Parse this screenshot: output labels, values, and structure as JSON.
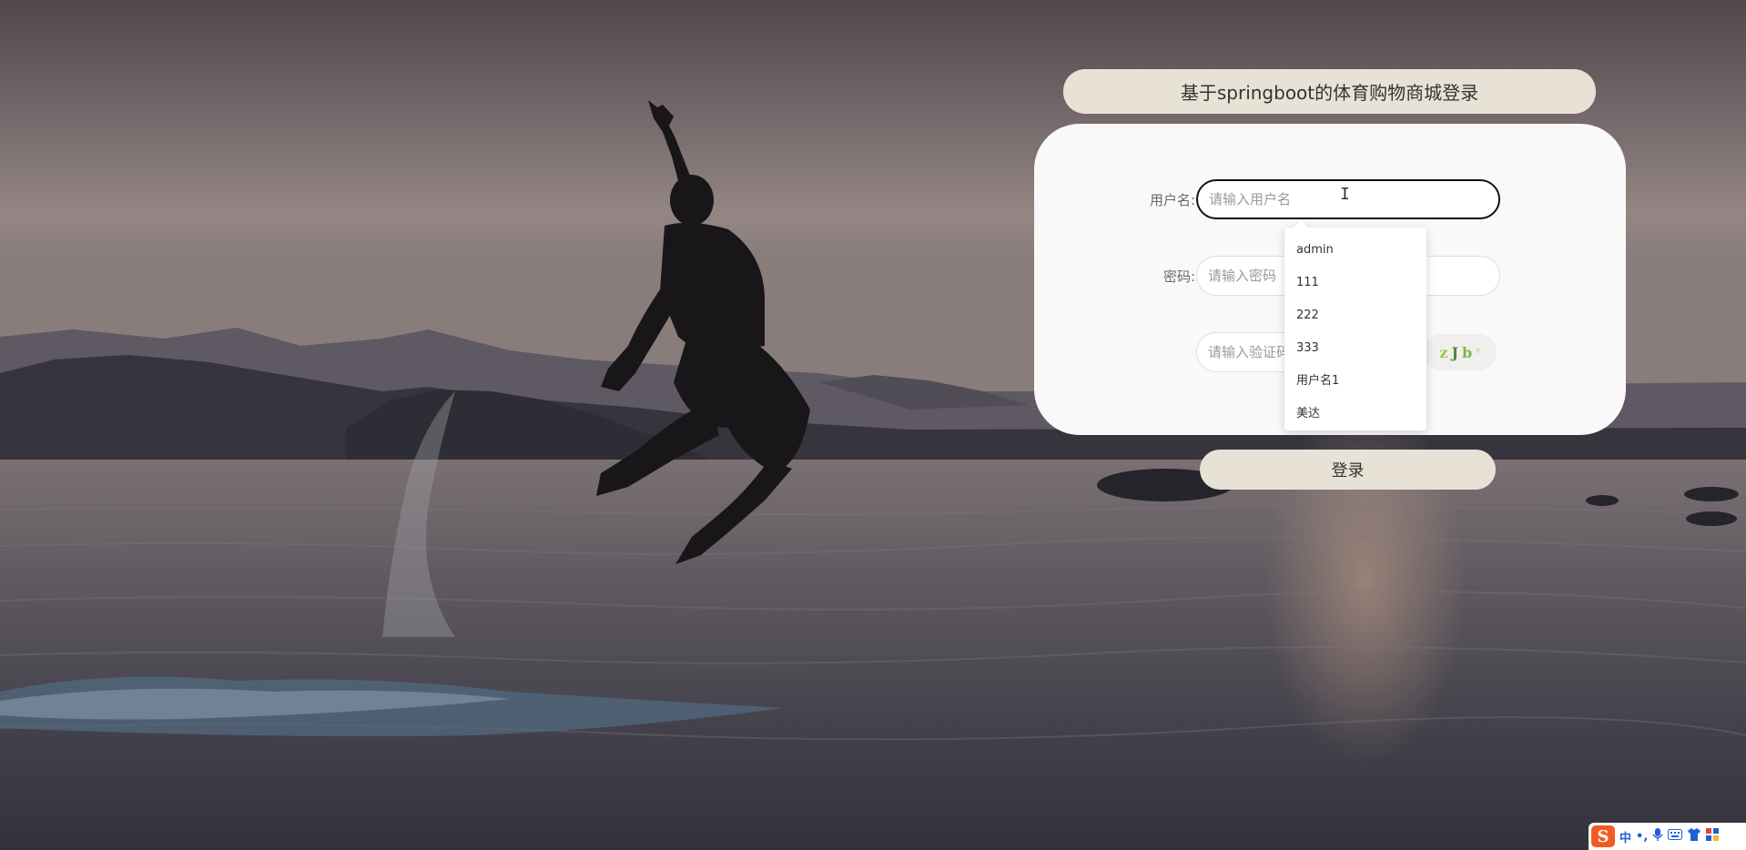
{
  "page": {
    "title": "基于springboot的体育购物商城登录"
  },
  "form": {
    "username": {
      "label": "用户名:",
      "placeholder": "请输入用户名",
      "value": ""
    },
    "password": {
      "label": "密码:",
      "placeholder": "请输入密码",
      "value": ""
    },
    "captcha": {
      "placeholder": "请输入验证码",
      "value": "",
      "image_chars": [
        "z",
        "J",
        "b",
        "ᵞ"
      ]
    },
    "login_button": "登录"
  },
  "autocomplete": {
    "items": [
      "admin",
      "111",
      "222",
      "333",
      "用户名1",
      "美达"
    ]
  },
  "ime_toolbar": {
    "logo": "S",
    "mode": "中",
    "punct": "•,",
    "icons": [
      "mic-icon",
      "keyboard-icon",
      "skin-icon",
      "grid-icon"
    ]
  },
  "colors": {
    "title_bg": "#e8e2d6",
    "card_bg": "#faf8f8",
    "button_bg": "#e8e2d6",
    "focused_border": "#111111",
    "ime_logo": "#f25a24"
  }
}
